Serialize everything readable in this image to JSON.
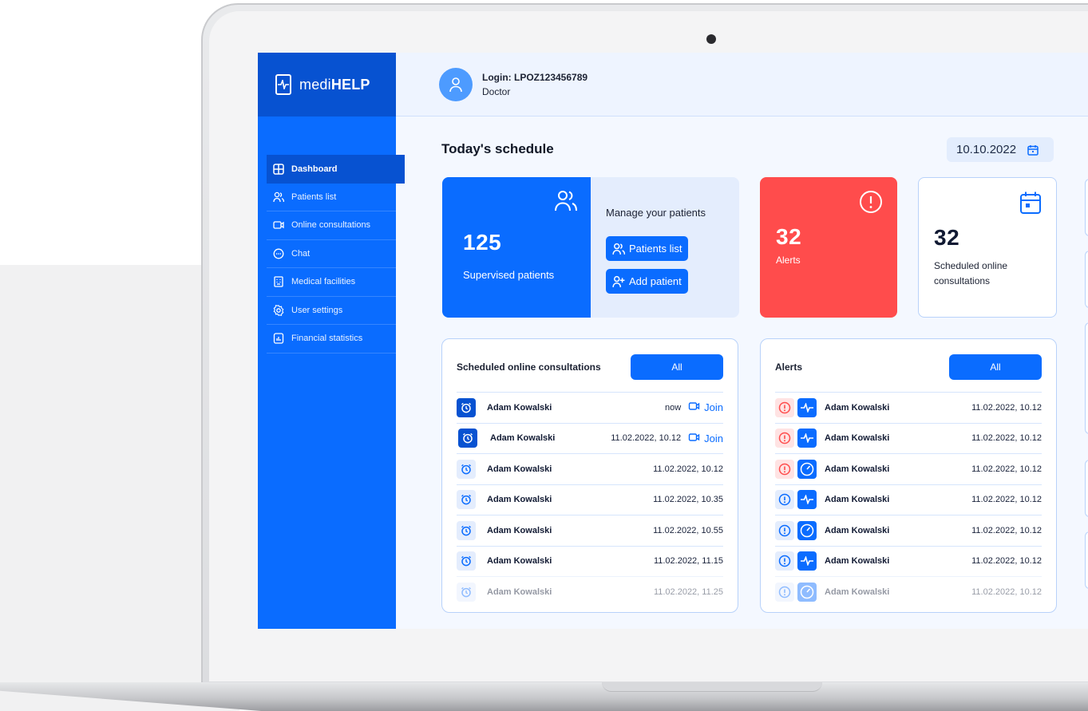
{
  "brand": {
    "prefix": "medi",
    "suffix": "HELP"
  },
  "user": {
    "login": "Login: LPOZ123456789",
    "role": "Doctor"
  },
  "sidebar": {
    "items": [
      {
        "label": "Dashboard",
        "icon": "dashboard-icon",
        "active": true
      },
      {
        "label": "Patients list",
        "icon": "users-icon"
      },
      {
        "label": "Online consultations",
        "icon": "video-icon"
      },
      {
        "label": "Chat",
        "icon": "chat-icon"
      },
      {
        "label": "Medical facilities",
        "icon": "building-icon"
      },
      {
        "label": "User settings",
        "icon": "gear-icon"
      },
      {
        "label": "Financial statistics",
        "icon": "stats-icon"
      }
    ]
  },
  "page": {
    "title": "Today's schedule",
    "date": "10.10.2022"
  },
  "patients_card": {
    "count": "125",
    "label": "Supervised patients",
    "manage_title": "Manage your patients",
    "list_button": "Patients list",
    "add_button": "Add patient"
  },
  "alerts_card": {
    "count": "32",
    "label": "Alerts"
  },
  "scheduled_card": {
    "count": "32",
    "label": "Scheduled online consultations"
  },
  "consultations_panel": {
    "title": "Scheduled online consultations",
    "all_button": "All",
    "rows": [
      {
        "name": "Adam Kowalski",
        "time": "now",
        "join": "Join",
        "style": "dark"
      },
      {
        "name": "Adam Kowalski",
        "time": "11.02.2022, 10.12",
        "join": "Join",
        "style": "dark"
      },
      {
        "name": "Adam Kowalski",
        "time": "11.02.2022, 10.12",
        "style": "light"
      },
      {
        "name": "Adam Kowalski",
        "time": "11.02.2022, 10.35",
        "style": "light"
      },
      {
        "name": "Adam Kowalski",
        "time": "11.02.2022, 10.55",
        "style": "light"
      },
      {
        "name": "Adam Kowalski",
        "time": "11.02.2022, 11.15",
        "style": "light"
      },
      {
        "name": "Adam Kowalski",
        "time": "11.02.2022, 11.25",
        "style": "fade"
      }
    ]
  },
  "alerts_panel": {
    "title": "Alerts",
    "all_button": "All",
    "rows": [
      {
        "name": "Adam Kowalski",
        "time": "11.02.2022, 10.12",
        "severity": "red",
        "type": "pulse-icon"
      },
      {
        "name": "Adam Kowalski",
        "time": "11.02.2022, 10.12",
        "severity": "red",
        "type": "pulse-icon"
      },
      {
        "name": "Adam Kowalski",
        "time": "11.02.2022, 10.12",
        "severity": "red",
        "type": "gauge-icon"
      },
      {
        "name": "Adam Kowalski",
        "time": "11.02.2022, 10.12",
        "severity": "blue",
        "type": "pulse-icon"
      },
      {
        "name": "Adam Kowalski",
        "time": "11.02.2022, 10.12",
        "severity": "blue",
        "type": "gauge-icon"
      },
      {
        "name": "Adam Kowalski",
        "time": "11.02.2022, 10.12",
        "severity": "blue",
        "type": "pulse-icon"
      },
      {
        "name": "Adam Kowalski",
        "time": "11.02.2022, 10.12",
        "severity": "blue",
        "type": "gauge-icon",
        "fade": true
      }
    ]
  },
  "colors": {
    "primary": "#0a6cff",
    "dark_primary": "#0752d1",
    "alert": "#ff4c4c",
    "panel_border": "#b8d2fa"
  }
}
